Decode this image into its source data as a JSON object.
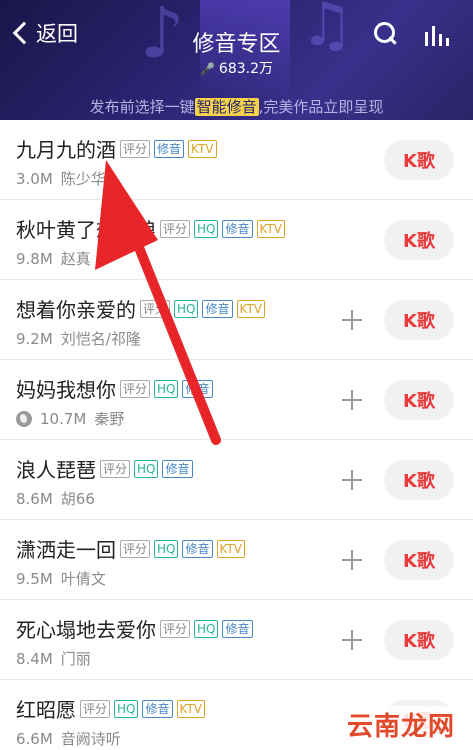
{
  "header": {
    "back_label": "返回",
    "title": "修音专区",
    "count": "683.2万",
    "promo_before": "发布前选择一键",
    "promo_highlight": "智能修音",
    "promo_after": ",完美作品立即呈现"
  },
  "songs": [
    {
      "title": "九月九的酒",
      "tags": [
        "评分",
        "修音",
        "KTV"
      ],
      "plays": "3.0M",
      "artist": "陈少华",
      "has_add": false,
      "has_globe": false,
      "button": "K歌"
    },
    {
      "title": "秋叶黄了想新娘",
      "tags": [
        "评分",
        "HQ",
        "修音",
        "KTV"
      ],
      "plays": "9.8M",
      "artist": "赵真",
      "has_add": false,
      "has_globe": false,
      "button": "K歌"
    },
    {
      "title": "想着你亲爱的",
      "tags": [
        "评分",
        "HQ",
        "修音",
        "KTV"
      ],
      "plays": "9.2M",
      "artist": "刘恺名/祁隆",
      "has_add": true,
      "has_globe": false,
      "button": "K歌"
    },
    {
      "title": "妈妈我想你",
      "tags": [
        "评分",
        "HQ",
        "修音"
      ],
      "plays": "10.7M",
      "artist": "秦野",
      "has_add": true,
      "has_globe": true,
      "button": "K歌"
    },
    {
      "title": "浪人琵琶",
      "tags": [
        "评分",
        "HQ",
        "修音"
      ],
      "plays": "8.6M",
      "artist": "胡66",
      "has_add": true,
      "has_globe": false,
      "button": "K歌"
    },
    {
      "title": "潇洒走一回",
      "tags": [
        "评分",
        "HQ",
        "修音",
        "KTV"
      ],
      "plays": "9.5M",
      "artist": "叶倩文",
      "has_add": true,
      "has_globe": false,
      "button": "K歌"
    },
    {
      "title": "死心塌地去爱你",
      "tags": [
        "评分",
        "HQ",
        "修音"
      ],
      "plays": "8.4M",
      "artist": "门丽",
      "has_add": true,
      "has_globe": false,
      "button": "K歌"
    },
    {
      "title": "红昭愿",
      "tags": [
        "评分",
        "HQ",
        "修音",
        "KTV"
      ],
      "plays": "6.6M",
      "artist": "音阙诗听",
      "has_add": false,
      "has_globe": false,
      "button": "K歌"
    }
  ],
  "watermark": "云南龙网",
  "colors": {
    "accent_red": "#e83b3b",
    "header_bg": "#2a2370",
    "arrow_red": "#e8262a"
  }
}
